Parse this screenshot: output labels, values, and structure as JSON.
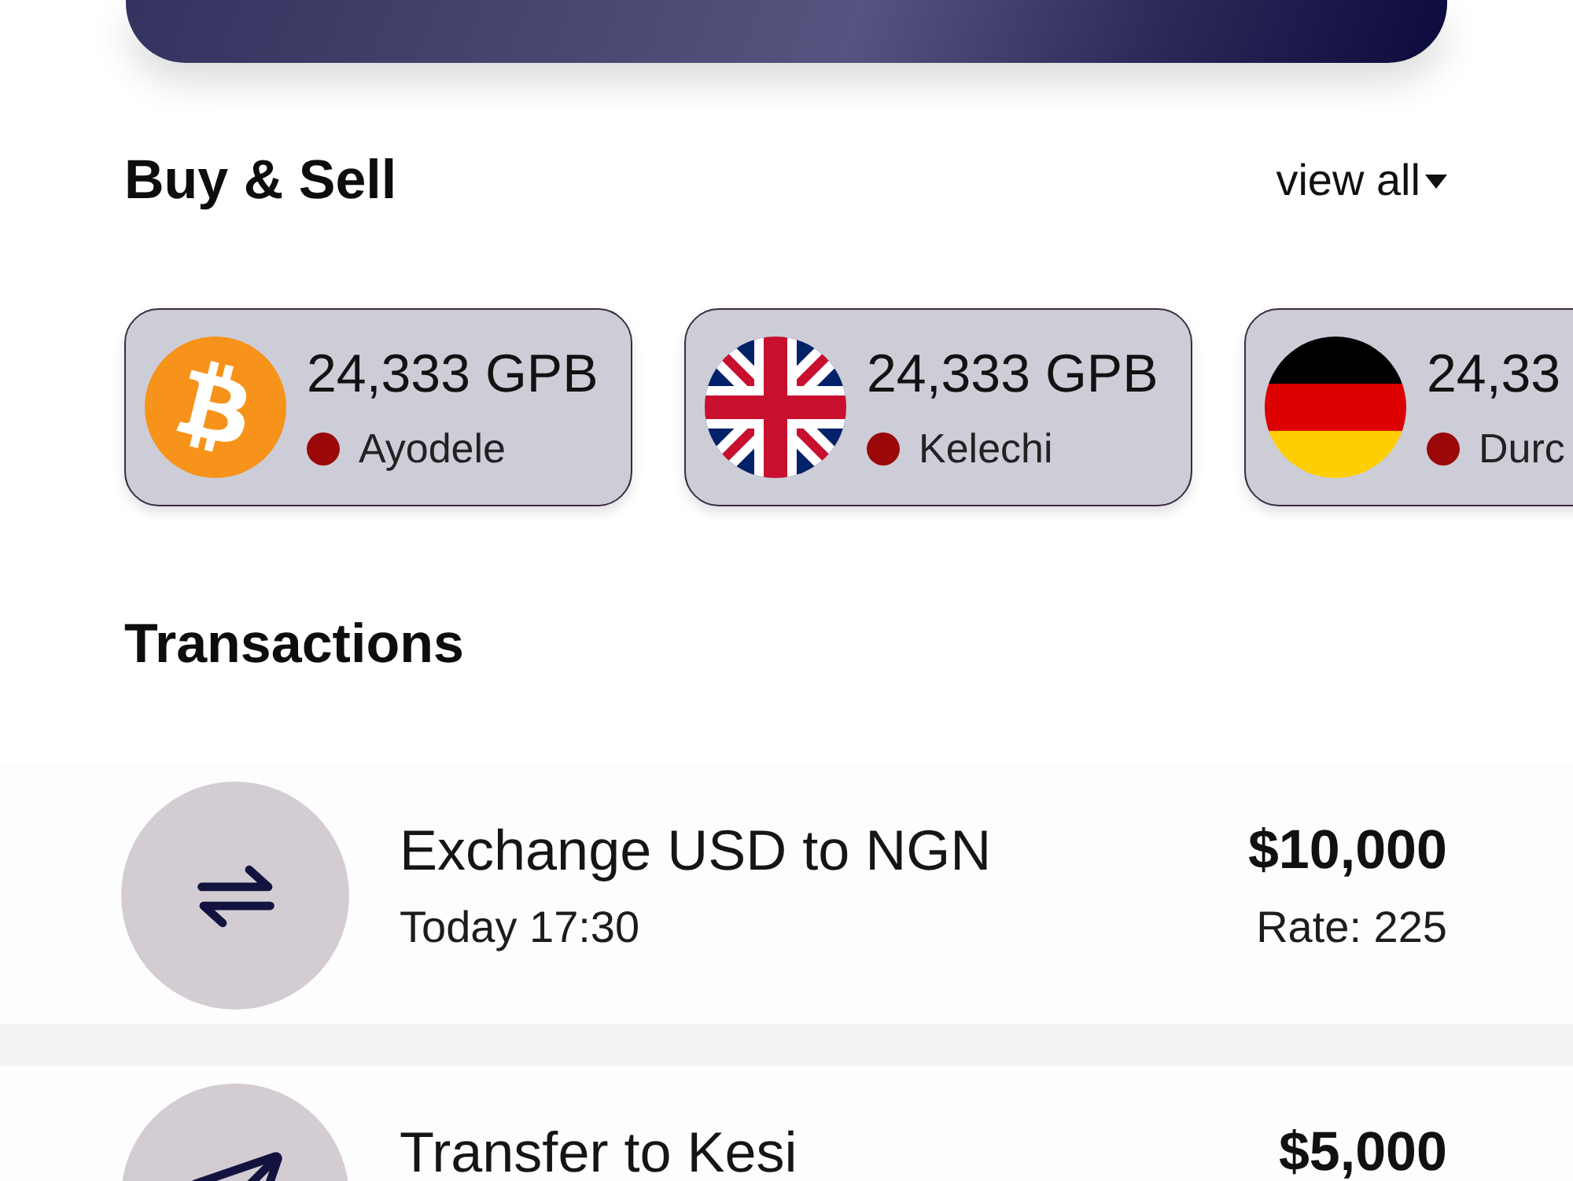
{
  "buy_sell": {
    "title": "Buy & Sell",
    "link": "view all",
    "cards": [
      {
        "kind": "bitcoin",
        "amount": "24,333 GPB",
        "name": "Ayodele"
      },
      {
        "kind": "uk",
        "amount": "24,333 GPB",
        "name": "Kelechi"
      },
      {
        "kind": "germany",
        "amount": "24,33",
        "name": "Durc"
      }
    ]
  },
  "transactions": {
    "title": "Transactions",
    "items": [
      {
        "kind": "exchange",
        "title": "Exchange USD to NGN",
        "time": "Today 17:30",
        "amount": "$10,000",
        "rate": "Rate: 225"
      },
      {
        "kind": "transfer",
        "title": "Transfer to Kesi",
        "amount": "$5,000"
      }
    ]
  }
}
